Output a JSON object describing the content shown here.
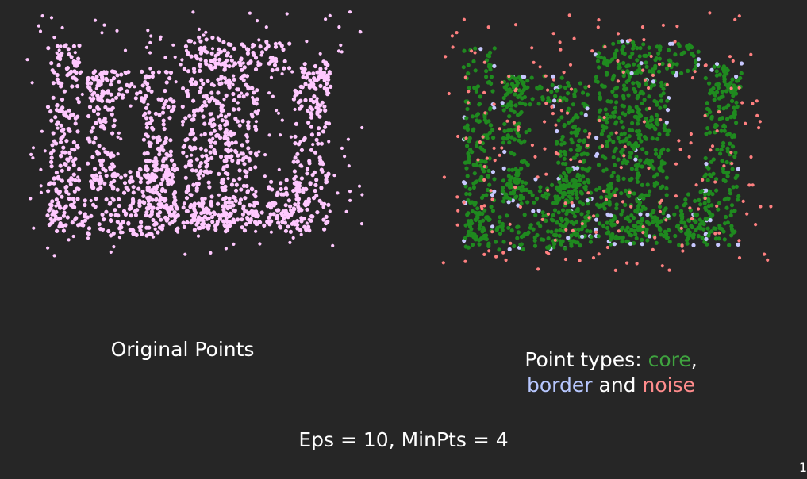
{
  "chart_data": [
    {
      "type": "scatter",
      "title": "Original Points",
      "series": [
        {
          "color": "#ffc8ff",
          "points": "~2500 points tracing 'U' 'D' 'T' 'J' shaped clusters plus sparse uniform noise"
        }
      ],
      "grid": false,
      "legend": "none"
    },
    {
      "type": "scatter",
      "title": "",
      "series": [
        {
          "name": "core",
          "color": "#1f8a1f"
        },
        {
          "name": "border",
          "color": "#c8c8ff"
        },
        {
          "name": "noise",
          "color": "#ff8080"
        }
      ],
      "grid": false,
      "legend": "none"
    }
  ],
  "captions": {
    "original": "Original Points",
    "types_prefix": "Point types: ",
    "core": "core",
    "comma": ",",
    "border": "border",
    "and": " and ",
    "noise": "noise"
  },
  "params": "Eps = 10, MinPts = 4",
  "slide_number": "1"
}
